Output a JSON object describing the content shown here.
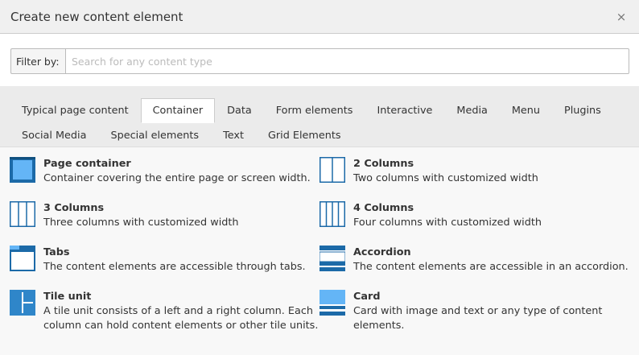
{
  "modal": {
    "title": "Create new content element",
    "close_symbol": "×"
  },
  "filter": {
    "label": "Filter by:",
    "placeholder": "Search for any content type",
    "value": ""
  },
  "tabs": [
    {
      "label": "Typical page content",
      "active": false
    },
    {
      "label": "Container",
      "active": true
    },
    {
      "label": "Data",
      "active": false
    },
    {
      "label": "Form elements",
      "active": false
    },
    {
      "label": "Interactive",
      "active": false
    },
    {
      "label": "Media",
      "active": false
    },
    {
      "label": "Menu",
      "active": false
    },
    {
      "label": "Plugins",
      "active": false
    },
    {
      "label": "Social Media",
      "active": false
    },
    {
      "label": "Special elements",
      "active": false
    },
    {
      "label": "Text",
      "active": false
    },
    {
      "label": "Grid Elements",
      "active": false
    }
  ],
  "items": [
    {
      "title": "Page container",
      "desc": "Container covering the entire page or screen width.",
      "icon": "page-container-icon"
    },
    {
      "title": "2 Columns",
      "desc": "Two columns with customized width",
      "icon": "two-columns-icon"
    },
    {
      "title": "3 Columns",
      "desc": "Three columns with customized width",
      "icon": "three-columns-icon"
    },
    {
      "title": "4 Columns",
      "desc": "Four columns with customized width",
      "icon": "four-columns-icon"
    },
    {
      "title": "Tabs",
      "desc": "The content elements are accessible through tabs.",
      "icon": "tabs-icon"
    },
    {
      "title": "Accordion",
      "desc": "The content elements are accessible in an accordion.",
      "icon": "accordion-icon"
    },
    {
      "title": "Tile unit",
      "desc": "A tile unit consists of a left and a right column. Each column can hold content elements or other tile units.",
      "icon": "tile-unit-icon"
    },
    {
      "title": "Card",
      "desc": "Card with image and text or any type of content elements.",
      "icon": "card-icon"
    }
  ],
  "colors": {
    "icon_dark": "#1c6aa8",
    "icon_light": "#64b5f6",
    "icon_mid": "#2f86c9"
  }
}
